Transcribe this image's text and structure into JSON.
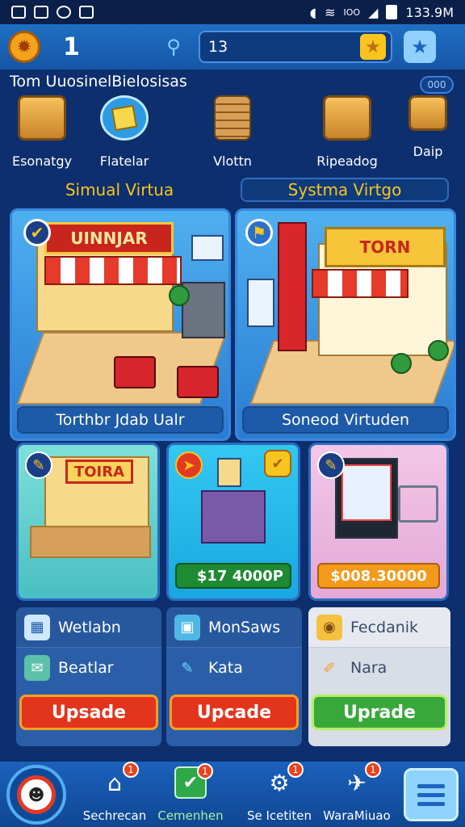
{
  "status_bar": {
    "time": "133.9M",
    "carrier_text": "IOO"
  },
  "header": {
    "level": "1",
    "search_value": "13"
  },
  "categories": {
    "title": "Tom UuosinelBielosisas",
    "pill": "000",
    "items": [
      {
        "label": "Esonatgy",
        "icon": "crates-icon"
      },
      {
        "label": "Flatelar",
        "icon": "sticky-note-icon"
      },
      {
        "label": "Vlottn",
        "icon": "stacked-boxes-icon"
      },
      {
        "label": "Ripeadog",
        "icon": "open-box-icon"
      },
      {
        "label": "Daip",
        "icon": "package-icon"
      }
    ]
  },
  "tabs": {
    "left": "Simual Virtua",
    "right": "Systma Virtgo"
  },
  "big_cards": [
    {
      "sign": "UINNJAR",
      "label": "Torthbr Jdab Ualr"
    },
    {
      "sign": "TORN",
      "label": "Soneod Virtuden"
    }
  ],
  "small_cards": [
    {
      "sign": "TOIRA",
      "price": ""
    },
    {
      "sign": "",
      "price": "$17 4000P"
    },
    {
      "sign": "",
      "price": "$008.30000"
    }
  ],
  "panels": [
    {
      "row1": "Wetlabn",
      "row2": "Beatlar",
      "button": "Upsade"
    },
    {
      "row1": "MonSaws",
      "row2": "Kata",
      "button": "Upcade"
    },
    {
      "row1": "Fecdanik",
      "row2": "Nara",
      "button": "Uprade"
    }
  ],
  "bottom_nav": [
    {
      "label": "Sechrecan",
      "badge": "1"
    },
    {
      "label": "Cemenhen",
      "badge": "1"
    },
    {
      "label": "Se Icetiten",
      "badge": "1"
    },
    {
      "label": "WaraMiuao",
      "badge": "1"
    }
  ],
  "colors": {
    "accent": "#f7c51e",
    "background": "#0d2f6e",
    "button_red": "#e3341c",
    "button_green": "#38a83b"
  }
}
